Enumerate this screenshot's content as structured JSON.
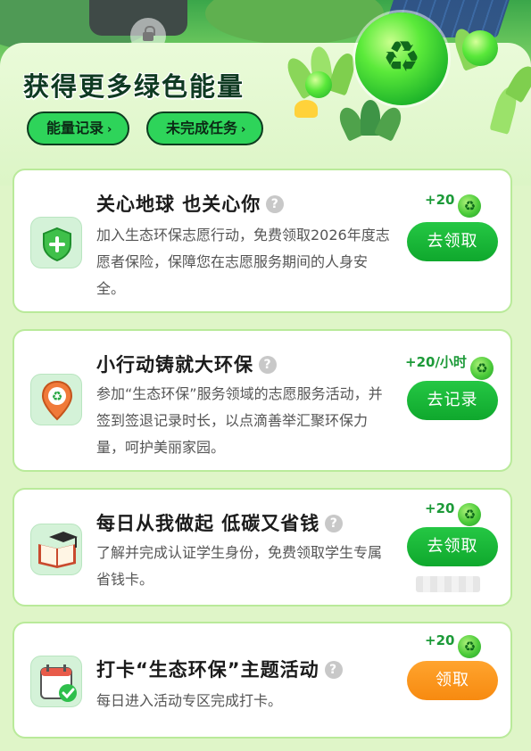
{
  "header": {
    "title": "获得更多绿色能量",
    "buttons": [
      "能量记录",
      "未完成任务"
    ],
    "chevron": "›"
  },
  "colors": {
    "accent_green": "#0fa82d",
    "accent_orange": "#f78a10",
    "reward_text": "#1c9a38",
    "card_border": "#b9ea9a"
  },
  "icons": {
    "recycle_symbol": "♻",
    "help_symbol": "?"
  },
  "tasks": [
    {
      "title": "关心地球 也关心你",
      "description": "加入生态环保志愿行动，免费领取2026年度志愿者保险，保障您在志愿服务期间的人身安全。",
      "reward": "+20",
      "button": "去领取",
      "icon": "shield-plus-icon"
    },
    {
      "title": "小行动铸就大环保",
      "description": "参加“生态环保”服务领域的志愿服务活动，并签到签退记录时长，以点滴善举汇聚环保力量，呵护美丽家园。",
      "reward": "+20/小时",
      "button": "去记录",
      "icon": "recycle-pin-icon"
    },
    {
      "title": "每日从我做起 低碳又省钱",
      "description": "了解并完成认证学生身份，免费领取学生专属省钱卡。",
      "reward": "+20",
      "button": "去领取",
      "icon": "graduation-book-icon"
    },
    {
      "title": "打卡“生态环保”主题活动",
      "description": "每日进入活动专区完成打卡。",
      "reward": "+20",
      "button": "领取",
      "icon": "calendar-check-icon"
    }
  ]
}
